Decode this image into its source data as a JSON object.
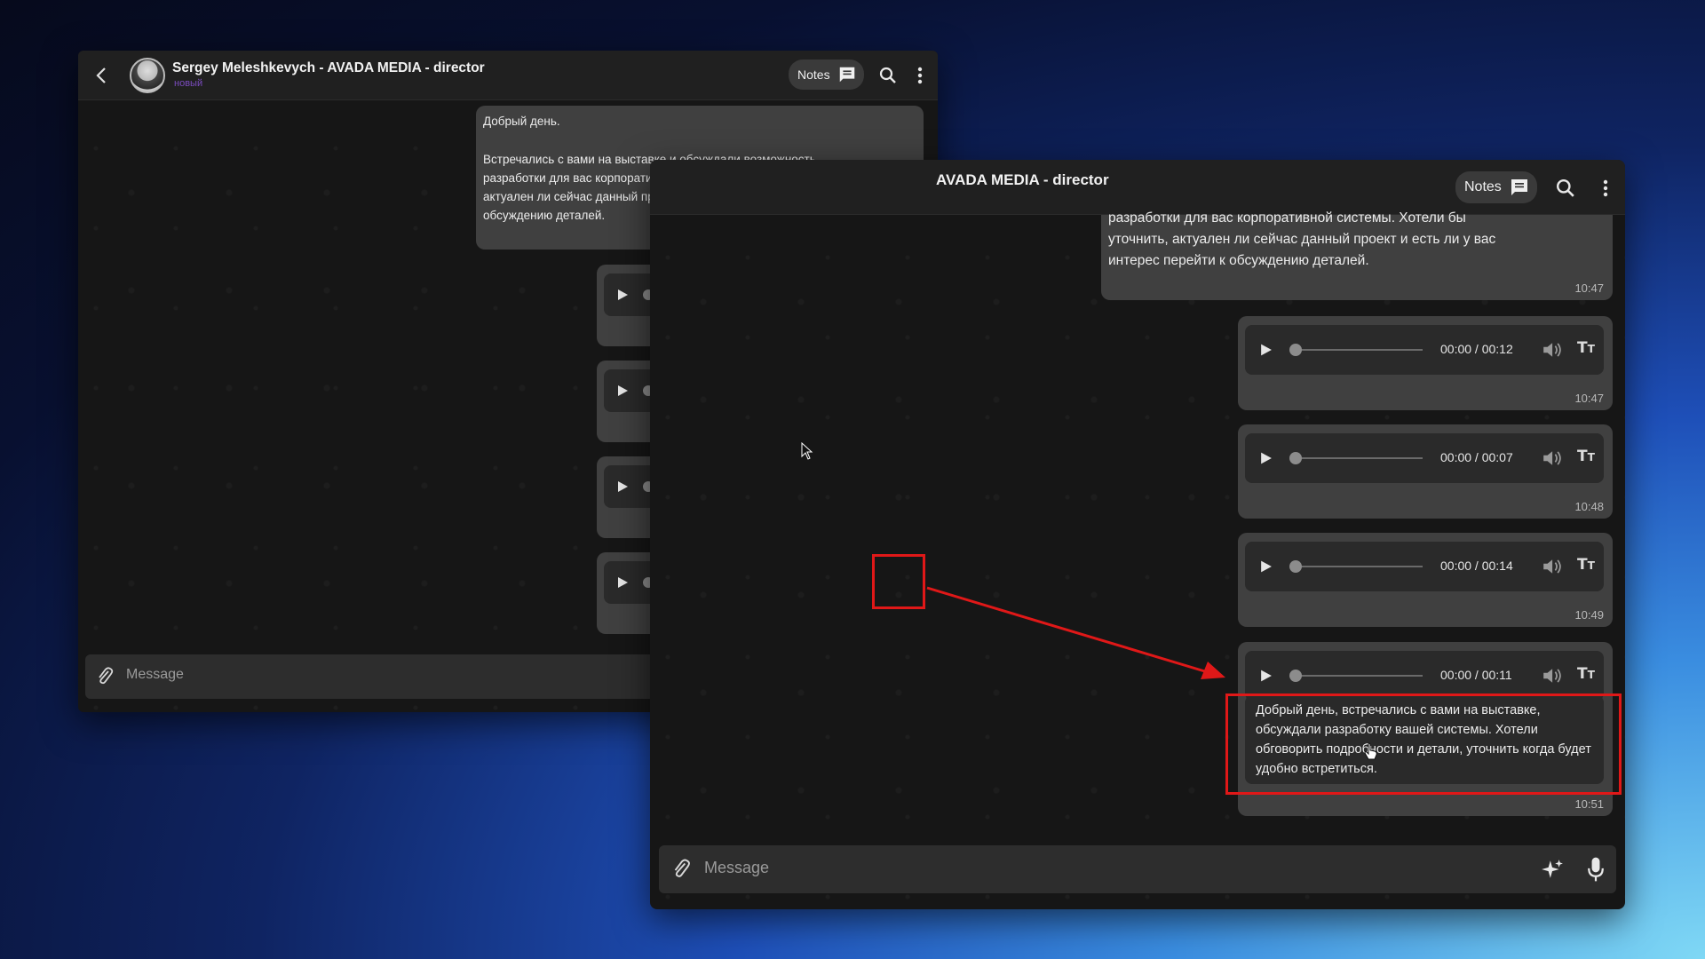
{
  "contact": {
    "name": "Sergey Meleshkevych - AVADA MEDIA - director",
    "name_partial": "AVADA MEDIA - director",
    "status": "новый"
  },
  "header": {
    "notes_label": "Notes"
  },
  "text_message": {
    "greeting": "Добрый день.",
    "body": "Встречались с вами на выставке и обсуждали возможность разработки для вас корпоративной системы. Хотели бы уточнить, актуален ли сейчас данный проект и есть ли у вас интерес перейти к обсуждению деталей.",
    "body_partial": "разработки для вас корпоративной системы. Хотели бы\nуточнить, актуален ли сейчас данный проект и есть ли у вас\nинтерес перейти к обсуждению деталей.",
    "time": "10:47"
  },
  "voice_messages": [
    {
      "position": "00:00 / 00:12",
      "time": "10:47"
    },
    {
      "position": "00:00 / 00:07",
      "time": "10:48"
    },
    {
      "position": "00:00 / 00:14",
      "time": "10:49"
    },
    {
      "position": "00:00 / 00:11",
      "time": "10:51"
    }
  ],
  "transcript": "Добрый день, встречались с вами на выставке, обсуждали разработку вашей системы. Хотели обговорить подробности и детали, уточнить когда будет удобно встретиться.",
  "composer": {
    "placeholder": "Message"
  },
  "icons": {
    "back": "chevron-left-icon",
    "notes": "message-square-icon",
    "search": "search-icon",
    "menu": "more-vertical-icon",
    "play": "play-icon",
    "volume": "volume-icon",
    "transcribe": "text-size-icon",
    "attach": "paperclip-icon",
    "ai": "sparkles-icon",
    "mic": "microphone-icon"
  },
  "colors": {
    "highlight": "#e01818",
    "status": "#7a4bbd"
  }
}
